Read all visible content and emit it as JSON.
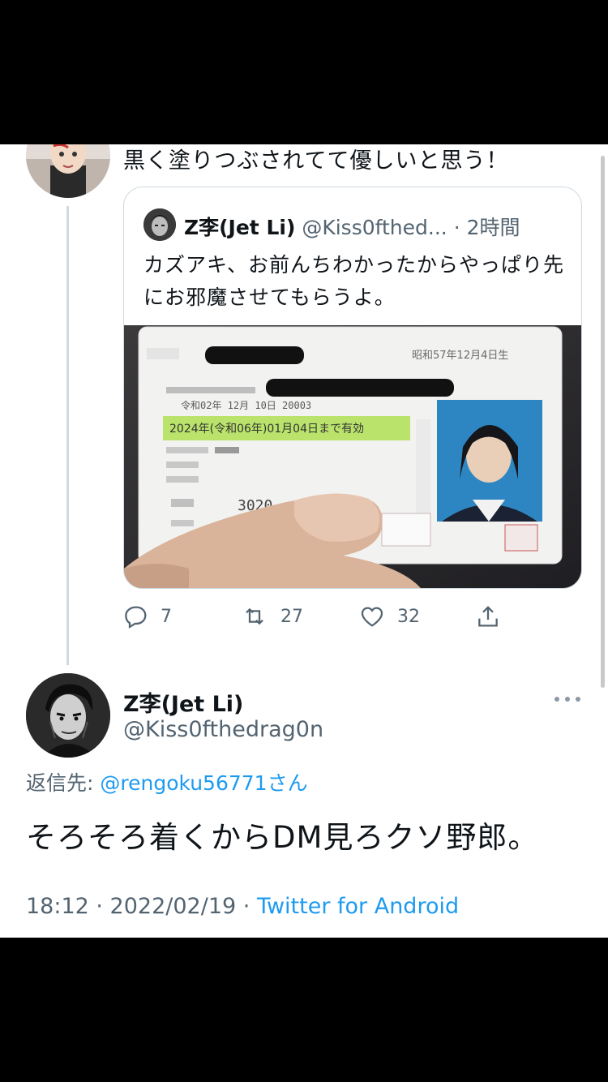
{
  "previous_tweet": {
    "text": "黒く塗りつぶされてて優しいと思う！",
    "quoted": {
      "name": "Z李(Jet Li)",
      "handle": "@Kiss0fthed...",
      "time": "· 2時間",
      "text": "カズアキ、お前んちわかったからやっぱり先にお邪魔させてもらうよ。",
      "card_date": "昭和57年12月4日生",
      "card_issue": "令和02年 12月 10日 20003",
      "card_expiry": "2024年(令和06年)01月04日まで有効",
      "card_number": "3020"
    },
    "actions": {
      "reply_count": "7",
      "retweet_count": "27",
      "like_count": "32"
    }
  },
  "main_tweet": {
    "name": "Z李(Jet Li)",
    "handle": "@Kiss0fthedrag0n",
    "reply_label": "返信先: ",
    "reply_mention": "@rengoku56771さん",
    "text": "そろそろ着くからDM見ろクソ野郎。",
    "timestamp": "18:12 · 2022/02/19 · ",
    "source": "Twitter for Android"
  },
  "colors": {
    "link": "#1d9bf0",
    "secondary_text": "#536471",
    "border": "#cfd9de"
  },
  "icons": [
    "reply-icon",
    "retweet-icon",
    "like-icon",
    "share-icon",
    "more-icon"
  ]
}
